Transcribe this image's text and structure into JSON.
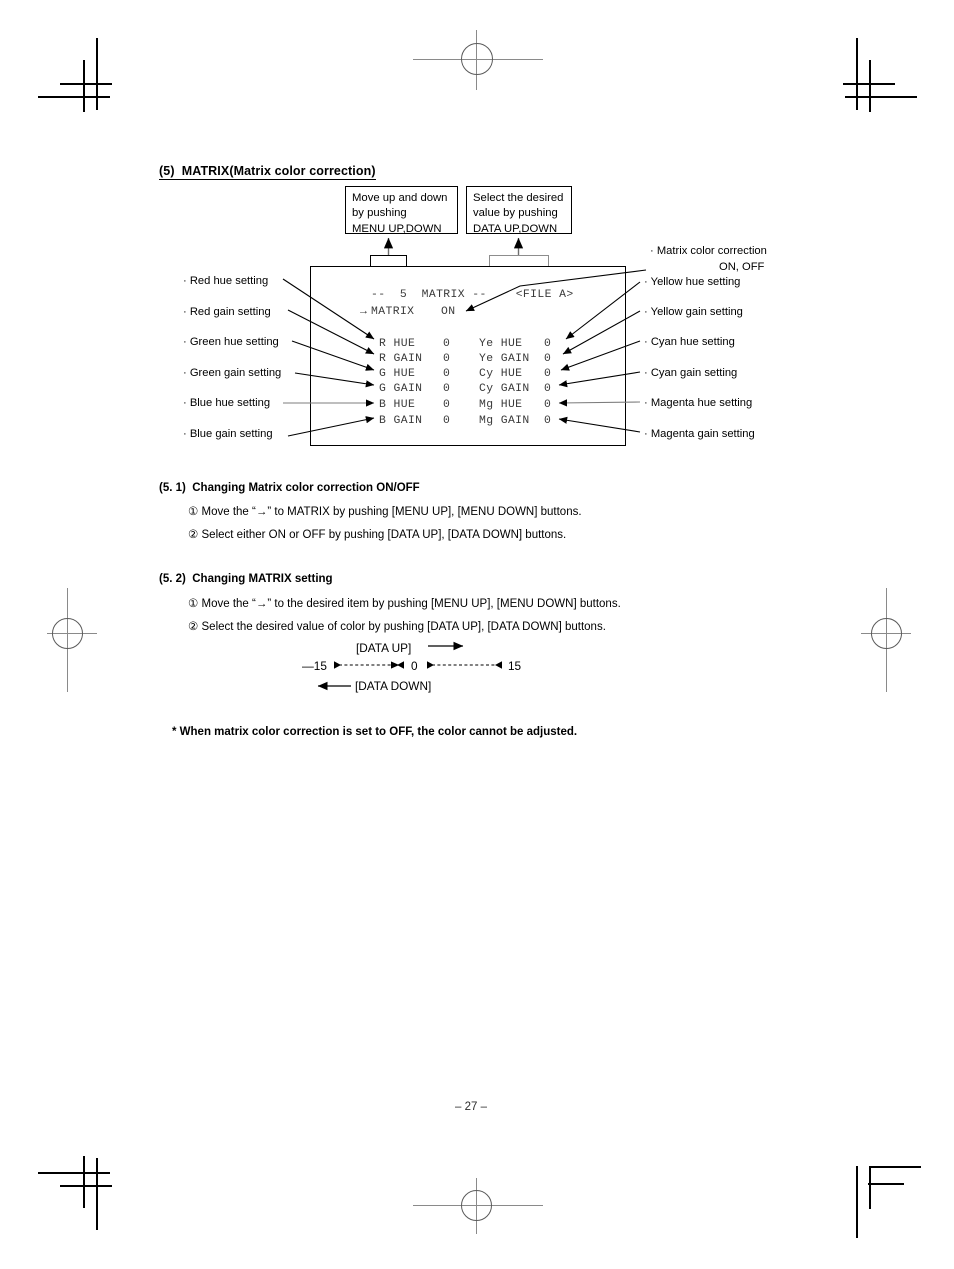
{
  "document": {
    "section_number": "(5)",
    "section_title": "MATRIX(Matrix color correction)",
    "page_number": "– 27 –"
  },
  "callouts": [
    {
      "id": "menu-updown",
      "line1": "Move up and down",
      "line2": "by pushing",
      "line3": "MENU UP,DOWN"
    },
    {
      "id": "data-select",
      "line1": "Select the desired",
      "line2": "value by pushing",
      "line3": "DATA UP,DOWN"
    }
  ],
  "osd": {
    "header_left": "--  5  MATRIX --",
    "header_right": "<FILE A>",
    "cursor": "→",
    "matrix_label": "MATRIX",
    "matrix_value": "ON",
    "rows": [
      {
        "left_label": "R HUE",
        "left_value": "0",
        "right_label": "Ye HUE",
        "right_value": "0"
      },
      {
        "left_label": "R GAIN",
        "left_value": "0",
        "right_label": "Ye GAIN",
        "right_value": "0"
      },
      {
        "left_label": "G HUE",
        "left_value": "0",
        "right_label": "Cy HUE",
        "right_value": "0"
      },
      {
        "left_label": "G GAIN",
        "left_value": "0",
        "right_label": "Cy GAIN",
        "right_value": "0"
      },
      {
        "left_label": "B HUE",
        "left_value": "0",
        "right_label": "Mg HUE",
        "right_value": "0"
      },
      {
        "left_label": "B GAIN",
        "left_value": "0",
        "right_label": "Mg GAIN",
        "right_value": "0"
      }
    ]
  },
  "labels_left": [
    "· Red hue setting",
    "· Red gain setting",
    "· Green hue setting",
    "· Green gain setting",
    "· Blue hue setting",
    "· Blue gain setting"
  ],
  "labels_right": [
    "· Matrix color correction",
    "ON, OFF",
    "· Yellow hue setting",
    "· Yellow gain setting",
    "· Cyan hue setting",
    "· Cyan gain setting",
    "· Magenta hue setting",
    "· Magenta gain setting"
  ],
  "subsection_1": {
    "number": "(5. 1)",
    "title": "Changing Matrix color correction ON/OFF",
    "steps": [
      {
        "marker": "①",
        "text": "Move the “→” to MATRIX by pushing [MENU UP], [MENU DOWN] buttons."
      },
      {
        "marker": "②",
        "text": "Select either ON or OFF by pushing [DATA UP], [DATA DOWN] buttons."
      }
    ]
  },
  "subsection_2": {
    "number": "(5. 2)",
    "title": "Changing MATRIX setting",
    "steps": [
      {
        "marker": "①",
        "text": "Move the “→” to the desired item by pushing [MENU UP], [MENU DOWN] buttons."
      },
      {
        "marker": "②",
        "text": "Select the desired value of color by pushing [DATA UP], [DATA DOWN] buttons."
      }
    ],
    "range_diagram": {
      "up_label": "[DATA UP]",
      "down_label": "[DATA DOWN]",
      "min_value": "—15",
      "center_value": "0",
      "max_value": "15"
    }
  },
  "footnote": "* When matrix color correction is set to OFF, the color cannot be adjusted."
}
